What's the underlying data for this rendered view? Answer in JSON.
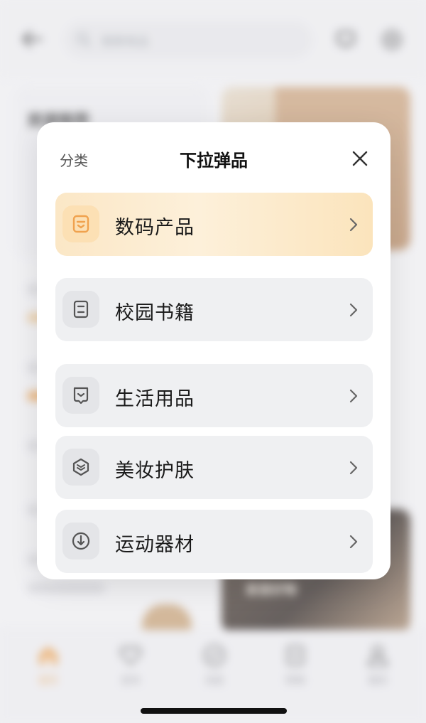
{
  "header": {
    "search_placeholder": "搜索商品"
  },
  "background": {
    "card_title": "资源推荐",
    "dark_card_label": "家居好物"
  },
  "tab_bar": {
    "items": [
      {
        "label": "首页",
        "icon": "home-icon",
        "active": true
      },
      {
        "label": "发布",
        "icon": "heart-icon",
        "active": false
      },
      {
        "label": "消息",
        "icon": "check-circle-icon",
        "active": false
      },
      {
        "label": "购物",
        "icon": "bag-icon",
        "active": false
      },
      {
        "label": "我的",
        "icon": "user-icon",
        "active": false
      }
    ]
  },
  "modal": {
    "tag": "分类",
    "title": "下拉弹品",
    "options": [
      {
        "label": "数码产品",
        "icon": "digital-icon",
        "selected": true
      },
      {
        "label": "校园书籍",
        "icon": "book-icon",
        "selected": false
      },
      {
        "label": "生活用品",
        "icon": "life-goods-icon",
        "selected": false
      },
      {
        "label": "美妆护肤",
        "icon": "beauty-icon",
        "selected": false
      },
      {
        "label": "运动器材",
        "icon": "sports-icon",
        "selected": false
      }
    ]
  },
  "colors": {
    "accent": "#f0a24e",
    "selected_bg": "#fbe7c6",
    "option_bg": "#eff0f2"
  }
}
